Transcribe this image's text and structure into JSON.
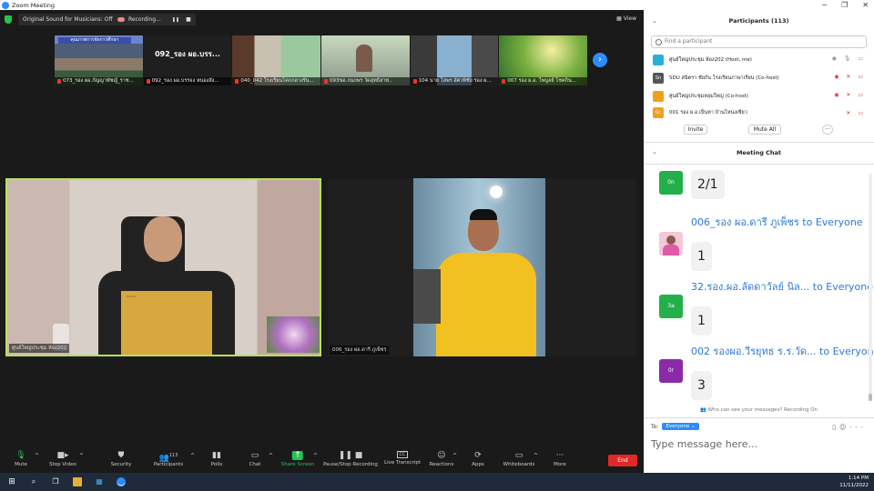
{
  "window": {
    "title": "Zoom Meeting",
    "minimize": "─",
    "maximize": "❐",
    "close": "✕"
  },
  "topbar": {
    "sound_label": "Original Sound for Musicians: Off",
    "recording_label": "Recording...",
    "pause_icon": "❚❚",
    "stop_icon": "■",
    "view_label": "View"
  },
  "thumbnails": [
    {
      "name": "073_รอง ผอ.กัญญาพัชญ์_ราช...",
      "headline": "คุณภาพการจัดการศึกษา"
    },
    {
      "name": "092_รอง ผอ.บรรจง หนองสัง...",
      "headline": "092_รอง ผอ.บรร..."
    },
    {
      "name": "040_042 โรงเรียนโคกกลางรัน...",
      "headline": ""
    },
    {
      "name": "093ขอ.กนกพร วัดสุทธิสาท..",
      "headline": ""
    },
    {
      "name": "104 นาย โสพร อัศวพิชัย รอง ผ...",
      "headline": ""
    },
    {
      "name": "007 รอง ผ.อ. ไพบูลย์ โชคกิน...",
      "headline": ""
    }
  ],
  "next_arrow": "›",
  "tiles": {
    "speaker_name": "ศูนย์ใหญ่ประชุม ห้อง202",
    "speaker_screen": "ENOVO",
    "guest_name": "006_รอง ผอ.ดารี ภูเพ็ชร"
  },
  "toolbar": {
    "mute": "Mute",
    "stop_video": "Stop Video",
    "security": "Security",
    "participants": "Participants",
    "participants_count": "113",
    "polls": "Polls",
    "chat": "Chat",
    "share_screen": "Share Screen",
    "pause_stop_recording": "Pause/Stop Recording",
    "live_transcript": "Live Transcript",
    "reactions": "Reactions",
    "apps": "Apps",
    "whiteboards": "Whiteboards",
    "more": "More",
    "end": "End",
    "cc_icon": "CC"
  },
  "participants_panel": {
    "title": "Participants (113)",
    "search_placeholder": "Find a participant",
    "rows": [
      {
        "initials": "",
        "name": "ศูนย์ใหญ่ประชุม ห้อง202 (Host, me)",
        "color": "#2ab0d8"
      },
      {
        "initials": "Sn",
        "name": "SDU สนิตรา ชัยกัน โรงเรียนภาษาเรียน (Co-host)",
        "color": "#555555"
      },
      {
        "initials": "",
        "name": "ศูนย์ใหญ่ประชุมหลุมใหญ่ (Co-host)",
        "color": "#f0a020"
      },
      {
        "initials": "0c",
        "name": "001 รอง ผ.อ.เปิ่นหา บ้านโหน่งเซียว",
        "color": "#f0a020"
      }
    ],
    "invite": "Invite",
    "mute_all": "Mute All",
    "more_btn": "···"
  },
  "chat": {
    "title": "Meeting Chat",
    "messages": [
      {
        "sender": "",
        "to": "",
        "text": "2/1",
        "initials": "0n",
        "color": "#23b04a"
      },
      {
        "sender": "006_รอง ผอ.ดารี ภูเพ็ชร",
        "to": "to Everyone",
        "text": "1",
        "initials": "",
        "color": "#e07ab0"
      },
      {
        "sender": "32.รอง.ผอ.ลัดดาวัลย์ นิล...",
        "to": "to Everyone",
        "text": "1",
        "initials": "3a",
        "color": "#23b04a"
      },
      {
        "sender": "002 รองผอ.วีรยุทธ ร.ร.วัด...",
        "to": "to Everyone",
        "text": "3",
        "initials": "0r",
        "color": "#8a2aa8"
      }
    ],
    "who_can_see": "Who can see your messages? Recording On",
    "to_label": "To:",
    "to_value": "Everyone",
    "compose_placeholder": "Type message here..."
  },
  "taskbar": {
    "time": "1:14 PM",
    "date": "11/11/2022"
  },
  "colors": {
    "accent": "#2d8cff",
    "green": "#23c552",
    "end": "#e02828"
  }
}
